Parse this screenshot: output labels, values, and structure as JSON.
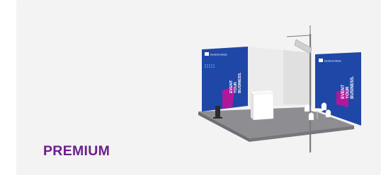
{
  "package": {
    "title": "PREMIUM"
  },
  "booth": {
    "company": "Deutsche Messe",
    "slogan": [
      "EVENT",
      "YOUR",
      "BUSINESS."
    ],
    "colors": {
      "wall_blue": "#1f47a8",
      "accent_magenta": "#b0189b",
      "floor_gray": "#8a8a8e",
      "title_purple": "#6a1f89"
    }
  }
}
